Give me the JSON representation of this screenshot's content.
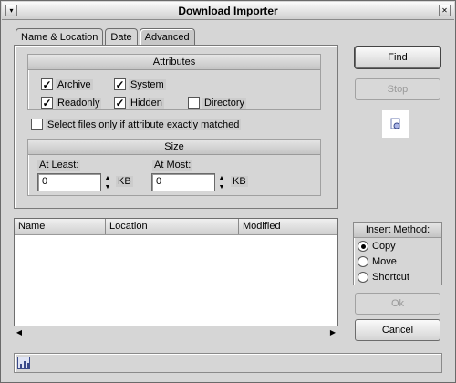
{
  "window": {
    "title": "Download Importer"
  },
  "tabs": [
    {
      "label": "Name & Location"
    },
    {
      "label": "Date"
    },
    {
      "label": "Advanced"
    }
  ],
  "attributes": {
    "header": "Attributes",
    "archive": "Archive",
    "system": "System",
    "readonly": "Readonly",
    "hidden": "Hidden",
    "directory": "Directory"
  },
  "exact_match": {
    "label": "Select files only if attribute exactly matched"
  },
  "size": {
    "header": "Size",
    "at_least_label": "At Least:",
    "at_least_value": "0",
    "at_least_unit": "KB",
    "at_most_label": "At Most:",
    "at_most_value": "0",
    "at_most_unit": "KB"
  },
  "buttons": {
    "find": "Find",
    "stop": "Stop",
    "ok": "Ok",
    "cancel": "Cancel"
  },
  "results": {
    "columns": [
      "Name",
      "Location",
      "Modified"
    ]
  },
  "insert_method": {
    "header": "Insert Method:",
    "options": [
      "Copy",
      "Move",
      "Shortcut"
    ]
  }
}
